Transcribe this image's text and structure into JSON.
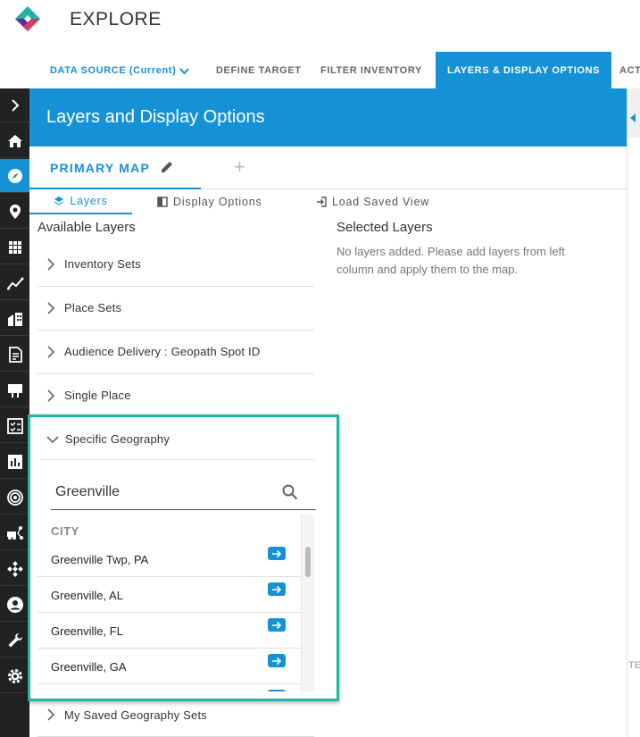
{
  "app": {
    "title": "EXPLORE",
    "logo_icon": "brand-logo-icon"
  },
  "nav_tabs": [
    {
      "label": "DATA SOURCE (Current)",
      "icon": "chevron-down-icon"
    },
    {
      "label": "DEFINE TARGET"
    },
    {
      "label": "FILTER INVENTORY"
    },
    {
      "label": "LAYERS & DISPLAY OPTIONS",
      "active": true
    },
    {
      "label": "ACT"
    }
  ],
  "sidebar": {
    "items": [
      {
        "icon": "chevron-right-icon"
      },
      {
        "icon": "home-icon"
      },
      {
        "icon": "compass-icon",
        "active": true
      },
      {
        "icon": "location-pin-icon"
      },
      {
        "icon": "grid-icon"
      },
      {
        "icon": "trend-icon"
      },
      {
        "icon": "buildings-icon"
      },
      {
        "icon": "document-icon"
      },
      {
        "icon": "billboard-icon"
      },
      {
        "icon": "checklist-icon"
      },
      {
        "icon": "bar-chart-icon"
      },
      {
        "icon": "target-icon"
      },
      {
        "icon": "truck-route-icon"
      },
      {
        "icon": "network-icon"
      },
      {
        "icon": "user-circle-icon"
      },
      {
        "icon": "wrench-icon"
      },
      {
        "icon": "gear-icon"
      }
    ]
  },
  "panel": {
    "title": "Layers and Display Options",
    "map_tab": "PRIMARY MAP",
    "add_tab": "+",
    "subtabs": {
      "layers": "Layers",
      "display": "Display Options",
      "load": "Load Saved View"
    },
    "available_title": "Available Layers",
    "selected_title": "Selected Layers",
    "selected_message": "No layers added. Please add layers from left column and apply them to the map.",
    "layer_groups": [
      {
        "label": "Inventory Sets"
      },
      {
        "label": "Place Sets"
      },
      {
        "label": "Audience Delivery : Geopath Spot ID"
      },
      {
        "label": "Single Place"
      }
    ],
    "specific_geography": {
      "label": "Specific Geography",
      "search_value": "Greenville",
      "section_heading": "CITY",
      "cities": [
        {
          "name": "Greenville Twp, PA"
        },
        {
          "name": "Greenville, AL"
        },
        {
          "name": "Greenville, FL"
        },
        {
          "name": "Greenville, GA"
        }
      ]
    },
    "saved_geography": {
      "label": "My Saved Geography Sets"
    }
  },
  "right_strip": {
    "text": "TE"
  },
  "colors": {
    "accent": "#1592d6",
    "highlight_border": "#1fb5a4",
    "sidebar_bg": "#222222"
  }
}
